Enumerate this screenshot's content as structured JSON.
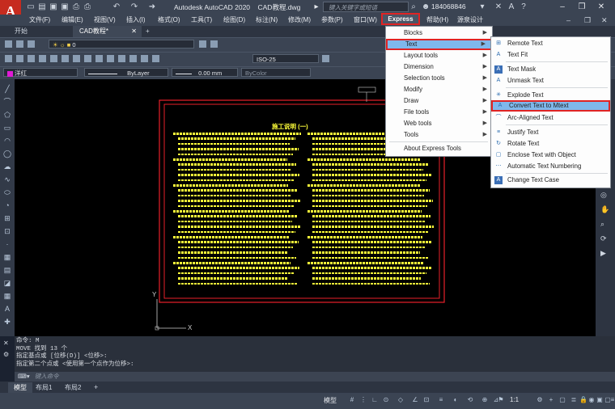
{
  "app": {
    "logo": "A",
    "title": "Autodesk AutoCAD 2020",
    "filename": "CAD教程.dwg",
    "search_placeholder": "键入关键字或短语",
    "user": "184068846"
  },
  "menubar": {
    "items": [
      "文件(F)",
      "编辑(E)",
      "视图(V)",
      "插入(I)",
      "格式(O)",
      "工具(T)",
      "绘图(D)",
      "标注(N)",
      "修改(M)",
      "参数(P)",
      "窗口(W)",
      "Express",
      "帮助(H)",
      "源泉设计"
    ]
  },
  "tabs": {
    "start": "开始",
    "doc": "CAD教程*"
  },
  "toolbar": {
    "layer_value": "0",
    "dimstyle": "ISO-25",
    "color_value": "洋红",
    "linetype": "ByLayer",
    "lineweight": "0.00 mm",
    "plotstyle": "ByColor"
  },
  "express_menu": {
    "items": [
      {
        "label": "Blocks",
        "submenu": true
      },
      {
        "label": "Text",
        "submenu": true
      },
      {
        "label": "Layout tools",
        "submenu": true
      },
      {
        "label": "Dimension",
        "submenu": true
      },
      {
        "label": "Selection tools",
        "submenu": true
      },
      {
        "label": "Modify",
        "submenu": true
      },
      {
        "label": "Draw",
        "submenu": true
      },
      {
        "label": "File tools",
        "submenu": true
      },
      {
        "label": "Web tools",
        "submenu": true
      },
      {
        "label": "Tools",
        "submenu": true
      },
      {
        "label": "About Express Tools",
        "submenu": false
      }
    ]
  },
  "text_submenu": {
    "items": [
      {
        "label": "Remote Text",
        "icon": "remote-text-icon"
      },
      {
        "label": "Text Fit",
        "icon": "text-fit-icon"
      },
      {
        "label": "Text Mask",
        "icon": "text-mask-icon"
      },
      {
        "label": "Unmask Text",
        "icon": "unmask-text-icon"
      },
      {
        "label": "Explode Text",
        "icon": "explode-text-icon"
      },
      {
        "label": "Convert Text to Mtext",
        "icon": "convert-text-icon"
      },
      {
        "label": "Arc-Aligned Text",
        "icon": "arc-text-icon"
      },
      {
        "label": "Justify Text",
        "icon": "justify-text-icon"
      },
      {
        "label": "Rotate Text",
        "icon": "rotate-text-icon"
      },
      {
        "label": "Enclose Text with Object",
        "icon": "enclose-text-icon"
      },
      {
        "label": "Automatic Text Numbering",
        "icon": "text-numbering-icon"
      },
      {
        "label": "Change Text Case",
        "icon": "text-case-icon"
      }
    ]
  },
  "drawing": {
    "title": "施工说明 (一)",
    "axis_y": "Y",
    "axis_x": "X"
  },
  "command": {
    "lines": [
      "命令: M",
      "MOVE 找到 13 个",
      "指定基点或 [位移(D)] <位移>:",
      "指定第二个点或 <使用第一个点作为位移>:"
    ],
    "input_placeholder": "键入命令"
  },
  "layout_tabs": [
    "模型",
    "布局1",
    "布局2"
  ],
  "status": {
    "model": "模型",
    "scale": "1:1"
  },
  "colors": {
    "accent_red": "#e02424",
    "highlight_blue": "#7fb8ec",
    "drawing_yellow": "#ffff3a",
    "frame_red": "#e8202a"
  }
}
